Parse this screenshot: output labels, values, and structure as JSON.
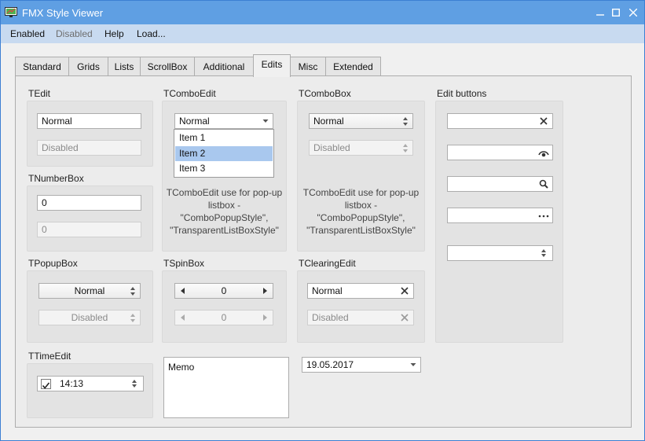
{
  "window": {
    "title": "FMX Style Viewer",
    "minimize_icon": "minimize-icon",
    "maximize_icon": "maximize-icon",
    "close_icon": "close-icon"
  },
  "menu": [
    "Enabled",
    "Disabled",
    "Help",
    "Load..."
  ],
  "tabs": [
    "Standard",
    "Grids",
    "Lists",
    "ScrollBox",
    "Additional",
    "Edits",
    "Misc",
    "Extended"
  ],
  "active_tab": "Edits",
  "tedit": {
    "label": "TEdit",
    "normal": "Normal",
    "disabled": "Disabled"
  },
  "tcomboedit": {
    "label": "TComboEdit",
    "value": "Normal",
    "items": [
      "Item 1",
      "Item 2",
      "Item 3"
    ],
    "selected_item": "Item 2",
    "desc_lines": [
      "TComboEdit use for pop-up",
      "listbox -",
      "\"ComboPopupStyle\",",
      "\"TransparentListBoxStyle\""
    ]
  },
  "tcombobox": {
    "label": "TComboBox",
    "normal": "Normal",
    "disabled": "Disabled",
    "desc_lines": [
      "TComboEdit use for pop-up",
      "listbox -",
      "\"ComboPopupStyle\",",
      "\"TransparentListBoxStyle\""
    ]
  },
  "edit_buttons": {
    "label": "Edit buttons",
    "icons": [
      "clear-icon",
      "password-eye-icon",
      "search-icon",
      "ellipsis-icon",
      "spin-updown-icon"
    ]
  },
  "tnumberbox": {
    "label": "TNumberBox",
    "value": "0",
    "disabled_value": "0"
  },
  "tpopupbox": {
    "label": "TPopupBox",
    "normal": "Normal",
    "disabled": "Disabled"
  },
  "tspinbox": {
    "label": "TSpinBox",
    "value": "0",
    "disabled_value": "0"
  },
  "tclearingedit": {
    "label": "TClearingEdit",
    "normal": "Normal",
    "disabled": "Disabled"
  },
  "ttimeedit": {
    "label": "TTimeEdit",
    "checked": true,
    "value": "14:13"
  },
  "memo": {
    "text": "Memo"
  },
  "dateedit": {
    "value": "19.05.2017"
  },
  "colors": {
    "titlebar": "#5f9fe3",
    "menubar": "#c8daf0",
    "selection": "#a9c8ee"
  }
}
